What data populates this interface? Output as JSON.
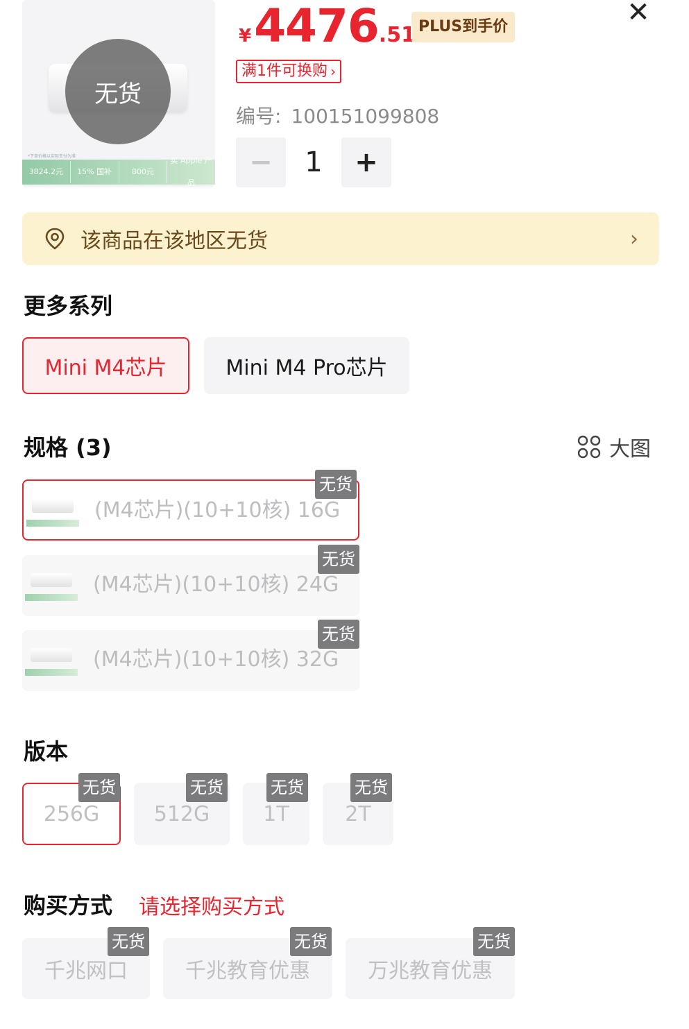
{
  "product_image": {
    "out_of_stock_label": "无货",
    "promo_note": "*下单价格以实际支付为准",
    "promo_strip": [
      "3824.2元",
      "15% 国补",
      "800元",
      "买 Apple 产品"
    ]
  },
  "price": {
    "currency": "¥",
    "integer": "4476",
    "decimal": ".51",
    "badge": "PLUS到手价"
  },
  "exchange_tag": {
    "label": "满1件可换购",
    "chevron": "›"
  },
  "sku": {
    "label": "编号:",
    "value": "100151099808"
  },
  "stepper": {
    "minus": "−",
    "quantity": "1",
    "plus": "+"
  },
  "close": "✕",
  "stock_notice": {
    "text": "该商品在该地区无货",
    "chevron": "›"
  },
  "series": {
    "title": "更多系列",
    "options": [
      "Mini M4芯片",
      "Mini M4 Pro芯片"
    ],
    "selected": 0
  },
  "specs": {
    "title": "规格 (3)",
    "big_image_label": "大图",
    "items": [
      {
        "label": "(M4芯片)(10+10核) 16G",
        "tag": "无货"
      },
      {
        "label": "(M4芯片)(10+10核) 24G",
        "tag": "无货"
      },
      {
        "label": "(M4芯片)(10+10核) 32G",
        "tag": "无货"
      }
    ]
  },
  "versions": {
    "title": "版本",
    "items": [
      {
        "label": "256G",
        "tag": "无货"
      },
      {
        "label": "512G",
        "tag": "无货"
      },
      {
        "label": "1T",
        "tag": "无货"
      },
      {
        "label": "2T",
        "tag": "无货"
      }
    ]
  },
  "purchase": {
    "title": "购买方式",
    "hint": "请选择购买方式",
    "items": [
      {
        "label": "千兆网口",
        "tag": "无货"
      },
      {
        "label": "千兆教育优惠",
        "tag": "无货"
      },
      {
        "label": "万兆教育优惠",
        "tag": "无货"
      }
    ]
  },
  "colors": {
    "accent": "#e8242f",
    "notice_bg": "#fcf2cf",
    "tag_bg": "#7b7b7e"
  }
}
